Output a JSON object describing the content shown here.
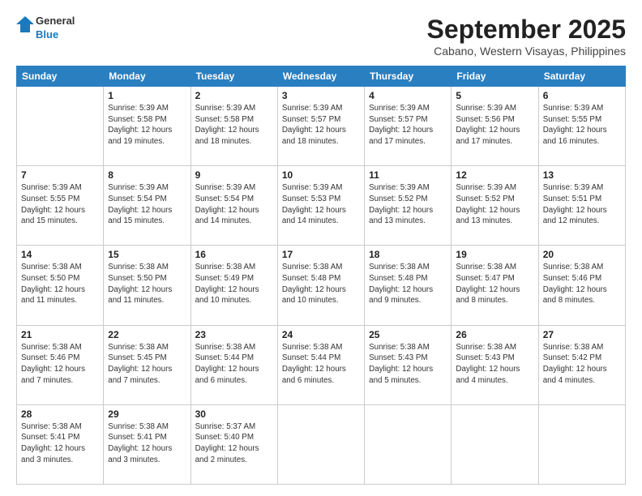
{
  "header": {
    "logo_general": "General",
    "logo_blue": "Blue",
    "month_title": "September 2025",
    "location": "Cabano, Western Visayas, Philippines"
  },
  "days_of_week": [
    "Sunday",
    "Monday",
    "Tuesday",
    "Wednesday",
    "Thursday",
    "Friday",
    "Saturday"
  ],
  "weeks": [
    [
      {
        "day": "",
        "info": ""
      },
      {
        "day": "1",
        "info": "Sunrise: 5:39 AM\nSunset: 5:58 PM\nDaylight: 12 hours\nand 19 minutes."
      },
      {
        "day": "2",
        "info": "Sunrise: 5:39 AM\nSunset: 5:58 PM\nDaylight: 12 hours\nand 18 minutes."
      },
      {
        "day": "3",
        "info": "Sunrise: 5:39 AM\nSunset: 5:57 PM\nDaylight: 12 hours\nand 18 minutes."
      },
      {
        "day": "4",
        "info": "Sunrise: 5:39 AM\nSunset: 5:57 PM\nDaylight: 12 hours\nand 17 minutes."
      },
      {
        "day": "5",
        "info": "Sunrise: 5:39 AM\nSunset: 5:56 PM\nDaylight: 12 hours\nand 17 minutes."
      },
      {
        "day": "6",
        "info": "Sunrise: 5:39 AM\nSunset: 5:55 PM\nDaylight: 12 hours\nand 16 minutes."
      }
    ],
    [
      {
        "day": "7",
        "info": "Sunrise: 5:39 AM\nSunset: 5:55 PM\nDaylight: 12 hours\nand 15 minutes."
      },
      {
        "day": "8",
        "info": "Sunrise: 5:39 AM\nSunset: 5:54 PM\nDaylight: 12 hours\nand 15 minutes."
      },
      {
        "day": "9",
        "info": "Sunrise: 5:39 AM\nSunset: 5:54 PM\nDaylight: 12 hours\nand 14 minutes."
      },
      {
        "day": "10",
        "info": "Sunrise: 5:39 AM\nSunset: 5:53 PM\nDaylight: 12 hours\nand 14 minutes."
      },
      {
        "day": "11",
        "info": "Sunrise: 5:39 AM\nSunset: 5:52 PM\nDaylight: 12 hours\nand 13 minutes."
      },
      {
        "day": "12",
        "info": "Sunrise: 5:39 AM\nSunset: 5:52 PM\nDaylight: 12 hours\nand 13 minutes."
      },
      {
        "day": "13",
        "info": "Sunrise: 5:39 AM\nSunset: 5:51 PM\nDaylight: 12 hours\nand 12 minutes."
      }
    ],
    [
      {
        "day": "14",
        "info": "Sunrise: 5:38 AM\nSunset: 5:50 PM\nDaylight: 12 hours\nand 11 minutes."
      },
      {
        "day": "15",
        "info": "Sunrise: 5:38 AM\nSunset: 5:50 PM\nDaylight: 12 hours\nand 11 minutes."
      },
      {
        "day": "16",
        "info": "Sunrise: 5:38 AM\nSunset: 5:49 PM\nDaylight: 12 hours\nand 10 minutes."
      },
      {
        "day": "17",
        "info": "Sunrise: 5:38 AM\nSunset: 5:48 PM\nDaylight: 12 hours\nand 10 minutes."
      },
      {
        "day": "18",
        "info": "Sunrise: 5:38 AM\nSunset: 5:48 PM\nDaylight: 12 hours\nand 9 minutes."
      },
      {
        "day": "19",
        "info": "Sunrise: 5:38 AM\nSunset: 5:47 PM\nDaylight: 12 hours\nand 8 minutes."
      },
      {
        "day": "20",
        "info": "Sunrise: 5:38 AM\nSunset: 5:46 PM\nDaylight: 12 hours\nand 8 minutes."
      }
    ],
    [
      {
        "day": "21",
        "info": "Sunrise: 5:38 AM\nSunset: 5:46 PM\nDaylight: 12 hours\nand 7 minutes."
      },
      {
        "day": "22",
        "info": "Sunrise: 5:38 AM\nSunset: 5:45 PM\nDaylight: 12 hours\nand 7 minutes."
      },
      {
        "day": "23",
        "info": "Sunrise: 5:38 AM\nSunset: 5:44 PM\nDaylight: 12 hours\nand 6 minutes."
      },
      {
        "day": "24",
        "info": "Sunrise: 5:38 AM\nSunset: 5:44 PM\nDaylight: 12 hours\nand 6 minutes."
      },
      {
        "day": "25",
        "info": "Sunrise: 5:38 AM\nSunset: 5:43 PM\nDaylight: 12 hours\nand 5 minutes."
      },
      {
        "day": "26",
        "info": "Sunrise: 5:38 AM\nSunset: 5:43 PM\nDaylight: 12 hours\nand 4 minutes."
      },
      {
        "day": "27",
        "info": "Sunrise: 5:38 AM\nSunset: 5:42 PM\nDaylight: 12 hours\nand 4 minutes."
      }
    ],
    [
      {
        "day": "28",
        "info": "Sunrise: 5:38 AM\nSunset: 5:41 PM\nDaylight: 12 hours\nand 3 minutes."
      },
      {
        "day": "29",
        "info": "Sunrise: 5:38 AM\nSunset: 5:41 PM\nDaylight: 12 hours\nand 3 minutes."
      },
      {
        "day": "30",
        "info": "Sunrise: 5:37 AM\nSunset: 5:40 PM\nDaylight: 12 hours\nand 2 minutes."
      },
      {
        "day": "",
        "info": ""
      },
      {
        "day": "",
        "info": ""
      },
      {
        "day": "",
        "info": ""
      },
      {
        "day": "",
        "info": ""
      }
    ]
  ]
}
